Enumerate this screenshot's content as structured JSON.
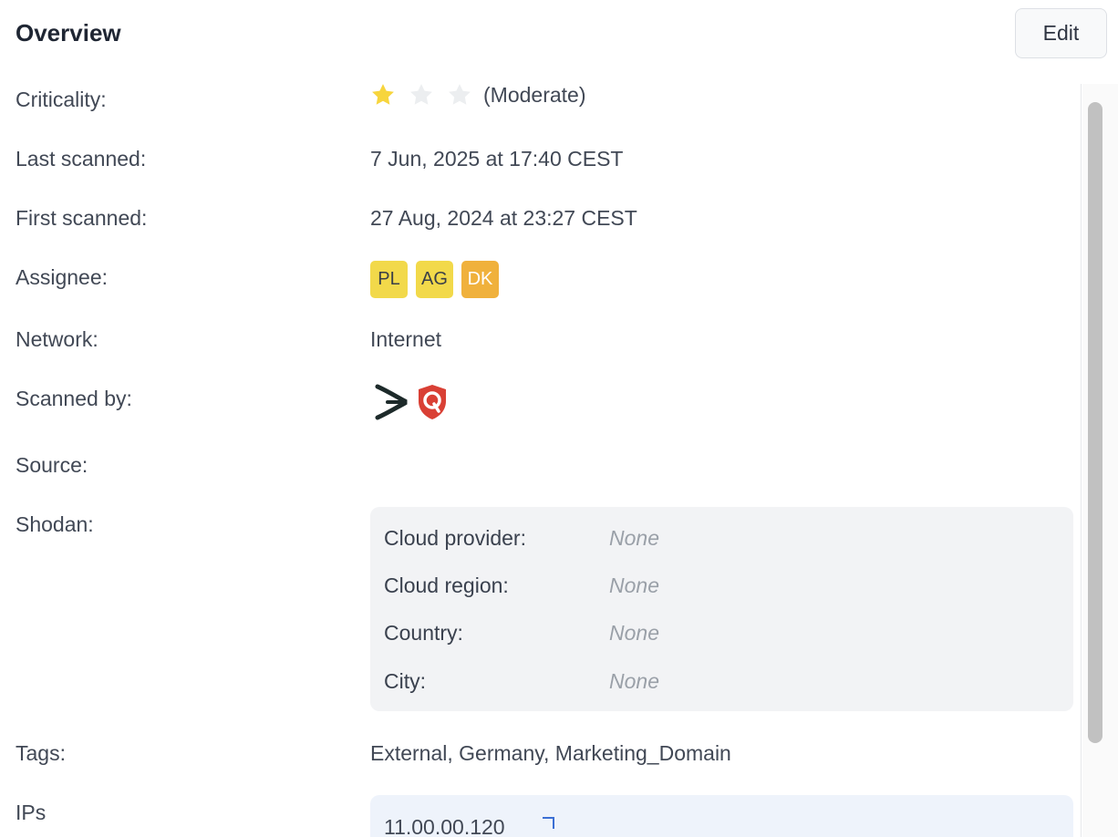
{
  "header": {
    "title": "Overview",
    "edit_label": "Edit"
  },
  "fields": {
    "criticality": {
      "label": "Criticality:",
      "rating_filled": 1,
      "rating_max": 3,
      "text": "(Moderate)"
    },
    "last_scanned": {
      "label": "Last scanned:",
      "value": "7 Jun, 2025 at 17:40 CEST"
    },
    "first_scanned": {
      "label": "First scanned:",
      "value": "27 Aug, 2024 at 23:27 CEST"
    },
    "assignee": {
      "label": "Assignee:",
      "avatars": [
        {
          "initials": "PL",
          "color": "#f2d94a"
        },
        {
          "initials": "AG",
          "color": "#f2d94a"
        },
        {
          "initials": "DK",
          "color": "#f0b13c"
        }
      ]
    },
    "network": {
      "label": "Network:",
      "value": "Internet"
    },
    "scanned_by": {
      "label": "Scanned by:",
      "icons": [
        "scanner-chevron-logo-icon",
        "qualys-logo-icon"
      ]
    },
    "source": {
      "label": "Source:"
    },
    "shodan": {
      "label": "Shodan:",
      "rows": [
        {
          "label": "Cloud provider:",
          "value": "None"
        },
        {
          "label": "Cloud region:",
          "value": "None"
        },
        {
          "label": "Country:",
          "value": "None"
        },
        {
          "label": "City:",
          "value": "None"
        }
      ]
    },
    "tags": {
      "label": "Tags:",
      "value": "External, Germany, Marketing_Domain"
    },
    "ips": {
      "label": "IPs",
      "value": "11.00.00.120"
    }
  },
  "colors": {
    "star_filled": "#f7d53d",
    "star_empty": "#eceef0",
    "qualys_red": "#d94035",
    "scroll_thumb": "#c1c1c1"
  }
}
